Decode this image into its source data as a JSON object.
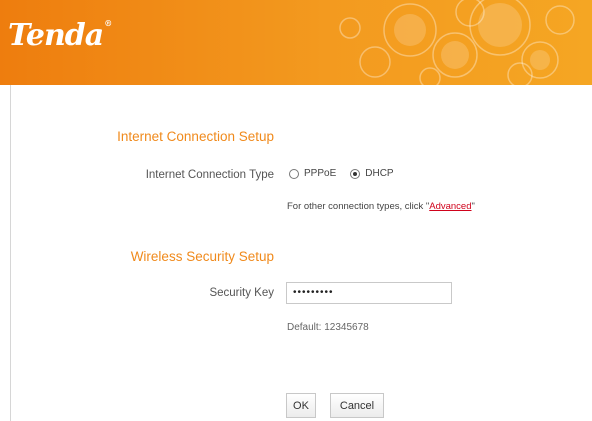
{
  "header": {
    "logo": "Tenda",
    "logo_mark": "®"
  },
  "internet": {
    "section_title": "Internet Connection Setup",
    "type_label": "Internet Connection Type",
    "options": [
      {
        "label": "PPPoE",
        "selected": false
      },
      {
        "label": "DHCP",
        "selected": true
      }
    ],
    "hint_prefix": "For other connection types, click \"",
    "hint_link": "Advanced",
    "hint_suffix": "\""
  },
  "wireless": {
    "section_title": "Wireless Security Setup",
    "key_label": "Security Key",
    "key_value": "•••••••••",
    "default_text": "Default: 12345678"
  },
  "buttons": {
    "ok": "OK",
    "cancel": "Cancel"
  },
  "colors": {
    "header_orange": "#ee7d0e",
    "section_title": "#f08a1c",
    "link": "#d0021b"
  }
}
